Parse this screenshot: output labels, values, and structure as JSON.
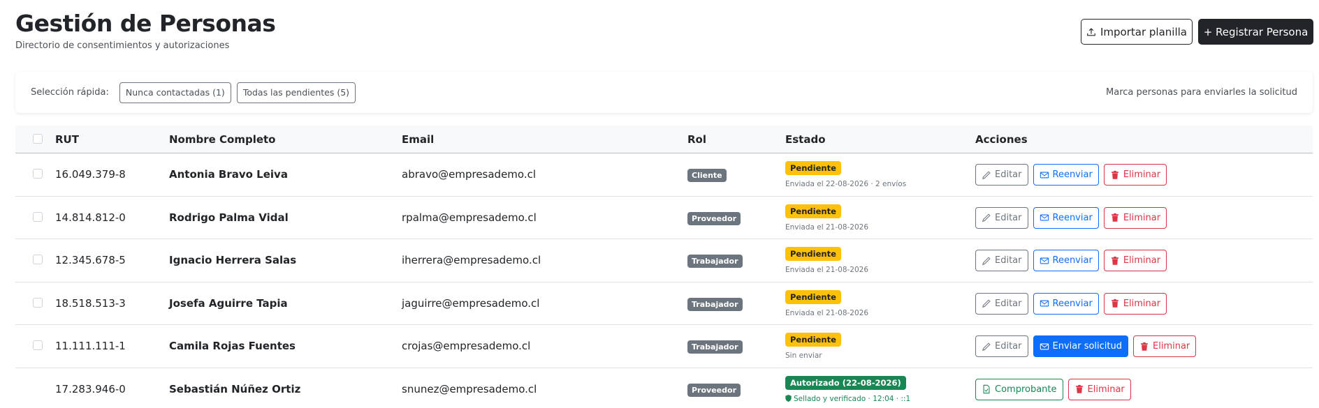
{
  "header": {
    "title": "Gestión de Personas",
    "subtitle": "Directorio de consentimientos y autorizaciones",
    "import_label": "Importar planilla",
    "register_label": "+ Registrar Persona"
  },
  "quick_select": {
    "label": "Selección rápida:",
    "chips": [
      "Nunca contactadas (1)",
      "Todas las pendientes (5)"
    ],
    "hint": "Marca personas para enviarles la solicitud"
  },
  "table": {
    "columns": [
      "RUT",
      "Nombre Completo",
      "Email",
      "Rol",
      "Estado",
      "Acciones"
    ],
    "rows": [
      {
        "rut": "16.049.379-8",
        "name": "Antonia Bravo Leiva",
        "email": "abravo@empresademo.cl",
        "role": "Cliente",
        "status": "Pendiente",
        "status_detail": "Enviada el 22-08-2026 · 2 envíos",
        "actions": [
          "Editar",
          "Reenviar",
          "Eliminar"
        ]
      },
      {
        "rut": "14.814.812-0",
        "name": "Rodrigo Palma Vidal",
        "email": "rpalma@empresademo.cl",
        "role": "Proveedor",
        "status": "Pendiente",
        "status_detail": "Enviada el 21-08-2026",
        "actions": [
          "Editar",
          "Reenviar",
          "Eliminar"
        ]
      },
      {
        "rut": "12.345.678-5",
        "name": "Ignacio Herrera Salas",
        "email": "iherrera@empresademo.cl",
        "role": "Trabajador",
        "status": "Pendiente",
        "status_detail": "Enviada el 21-08-2026",
        "actions": [
          "Editar",
          "Reenviar",
          "Eliminar"
        ]
      },
      {
        "rut": "18.518.513-3",
        "name": "Josefa Aguirre Tapia",
        "email": "jaguirre@empresademo.cl",
        "role": "Trabajador",
        "status": "Pendiente",
        "status_detail": "Enviada el 21-08-2026",
        "actions": [
          "Editar",
          "Reenviar",
          "Eliminar"
        ]
      },
      {
        "rut": "11.111.111-1",
        "name": "Camila Rojas Fuentes",
        "email": "crojas@empresademo.cl",
        "role": "Trabajador",
        "status": "Pendiente",
        "status_detail": "Sin enviar",
        "actions": [
          "Editar",
          "Enviar solicitud",
          "Eliminar"
        ]
      },
      {
        "rut": "17.283.946-0",
        "name": "Sebastián Núñez Ortiz",
        "email": "snunez@empresademo.cl",
        "role": "Proveedor",
        "status": "Autorizado (22-08-2026)",
        "status_detail": "Sellado y verificado · 12:04 · ::1",
        "actions": [
          "Comprobante",
          "Eliminar"
        ]
      }
    ]
  },
  "colors": {
    "pending": "#ffc107",
    "authorized": "#198754",
    "primary": "#0d6efd",
    "danger": "#dc3545",
    "role_badge": "#6c757d"
  }
}
